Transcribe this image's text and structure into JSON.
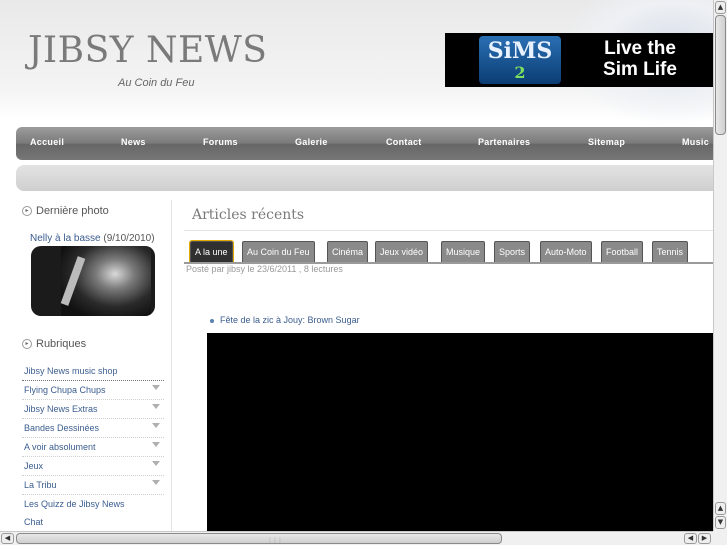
{
  "header": {
    "site_title": "JIBSY NEWS",
    "site_subtitle": "Au Coin du Feu",
    "banner": {
      "brand": "SiMS",
      "brand_number": "2",
      "slogan_line1": "Live the",
      "slogan_line2": "Sim Life"
    }
  },
  "nav": {
    "items": [
      "Accueil",
      "News",
      "Forums",
      "Galerie",
      "Contact",
      "Partenaires",
      "Sitemap",
      "Music"
    ]
  },
  "sidebar": {
    "photo_box_title": "Dernière photo",
    "photo_caption": "Nelly à la basse",
    "photo_date": "(9/10/2010)",
    "rubriques_title": "Rubriques",
    "menu": [
      {
        "label": "Jibsy News music shop",
        "has_arrow": false
      },
      {
        "label": "Flying Chupa Chups",
        "has_arrow": true
      },
      {
        "label": "Jibsy News Extras",
        "has_arrow": true
      },
      {
        "label": "Bandes Dessinées",
        "has_arrow": true
      },
      {
        "label": "A voir absolument",
        "has_arrow": true
      },
      {
        "label": "Jeux",
        "has_arrow": true
      },
      {
        "label": "La Tribu",
        "has_arrow": true
      },
      {
        "label": "Les Quizz de Jibsy News",
        "has_arrow": false
      },
      {
        "label": "Chat",
        "has_arrow": false
      }
    ]
  },
  "main": {
    "section_title": "Articles récents",
    "tabs": [
      "A la une",
      "Au Coin du Feu",
      "Cinéma",
      "Jeux vidéo",
      "Musique",
      "Sports",
      "Auto-Moto",
      "Football",
      "Tennis"
    ],
    "active_tab": "A la une",
    "post_meta": "Posté par jibsy le 23/6/2011 , 8 lectures",
    "article_link": "Fête de la zic à Jouy: Brown Sugar"
  },
  "colors": {
    "link": "#3b5d8f",
    "nav_bg": "#7a7a7a",
    "tab_active": "#303030",
    "tab_inactive": "#8a8a8a"
  }
}
